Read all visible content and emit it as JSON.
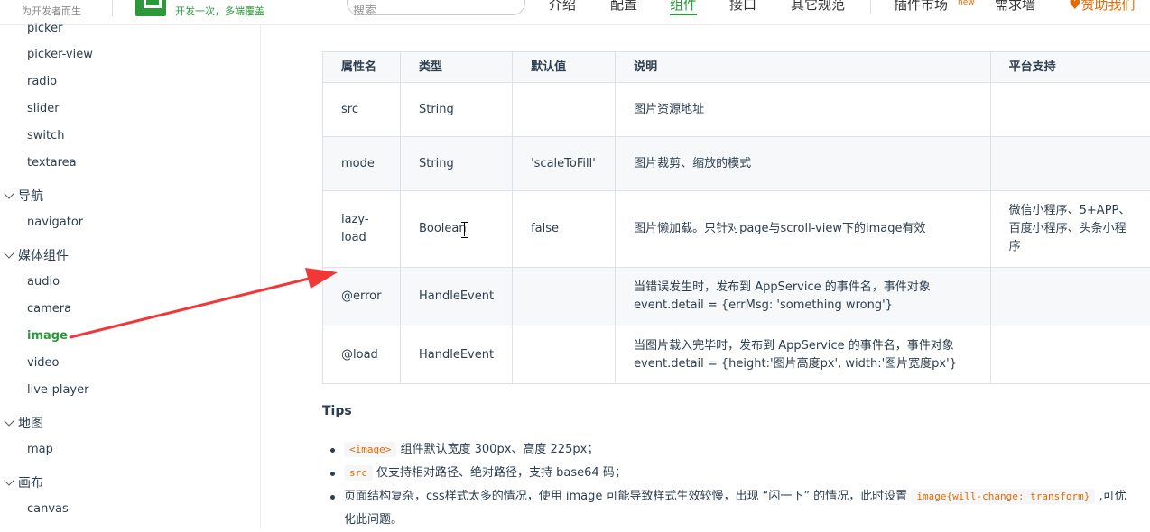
{
  "header": {
    "slogan": "为开发者而生",
    "logo_tagline": "开发一次，多端覆盖",
    "search_placeholder": "搜索",
    "nav": [
      {
        "label": "介绍"
      },
      {
        "label": "配置"
      },
      {
        "label": "组件"
      },
      {
        "label": "接口"
      },
      {
        "label": "其它规范"
      },
      {
        "label": "插件市场"
      },
      {
        "label": "需求墙"
      }
    ],
    "new_badge": "new",
    "sponsor": "赞助我们"
  },
  "sidebar": {
    "items": [
      {
        "label": "picker"
      },
      {
        "label": "picker-view"
      },
      {
        "label": "radio"
      },
      {
        "label": "slider"
      },
      {
        "label": "switch"
      },
      {
        "label": "textarea"
      }
    ],
    "groups": [
      {
        "label": "导航",
        "items": [
          {
            "label": "navigator"
          }
        ]
      },
      {
        "label": "媒体组件",
        "items": [
          {
            "label": "audio"
          },
          {
            "label": "camera"
          },
          {
            "label": "image"
          },
          {
            "label": "video"
          },
          {
            "label": "live-player"
          }
        ]
      },
      {
        "label": "地图",
        "items": [
          {
            "label": "map"
          }
        ]
      },
      {
        "label": "画布",
        "items": [
          {
            "label": "canvas"
          }
        ]
      }
    ],
    "active_item": "image"
  },
  "main": {
    "table": {
      "headers": [
        "属性名",
        "类型",
        "默认值",
        "说明",
        "平台支持"
      ],
      "rows": [
        [
          "src",
          "String",
          "",
          "图片资源地址",
          ""
        ],
        [
          "mode",
          "String",
          "'scaleToFill'",
          "图片裁剪、缩放的模式",
          ""
        ],
        [
          "lazy-load",
          "Boolean",
          "false",
          "图片懒加载。只针对page与scroll-view下的image有效",
          "微信小程序、5+APP、百度小程序、头条小程序"
        ],
        [
          "@error",
          "HandleEvent",
          "",
          "当错误发生时，发布到 AppService 的事件名，事件对象event.detail = {errMsg: 'something wrong'}",
          ""
        ],
        [
          "@load",
          "HandleEvent",
          "",
          "当图片载入完毕时，发布到 AppService 的事件名，事件对象event.detail = {height:'图片高度px', width:'图片宽度px'}",
          ""
        ]
      ]
    },
    "tips_title": "Tips",
    "tips": [
      {
        "code": "<image>",
        "text": "组件默认宽度 300px、高度 225px；"
      },
      {
        "code": "src",
        "text": "仅支持相对路径、绝对路径，支持 base64 码；"
      },
      {
        "pre": "页面结构复杂，css样式太多的情况，使用 image 可能导致样式生效较慢，出现 “闪一下” 的情况，此时设置 ",
        "code": "image{will-change: transform}",
        "text": " ,可优化此问题。"
      }
    ]
  },
  "colors": {
    "accent": "#2b9939",
    "code": "#e96900",
    "arrow": "#f03838"
  }
}
